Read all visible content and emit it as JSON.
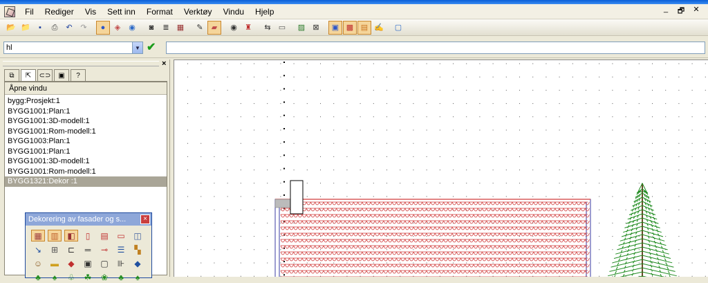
{
  "menubar": {
    "items": [
      "Fil",
      "Rediger",
      "Vis",
      "Sett inn",
      "Format",
      "Verktøy",
      "Vindu",
      "Hjelp"
    ],
    "window_controls": [
      "_",
      "🗗",
      "✕"
    ]
  },
  "toolbar": {
    "buttons": [
      "open-folder",
      "folder",
      "save",
      "print",
      "undo",
      "redo",
      "sep",
      "sphere",
      "cube",
      "blue-sphere",
      "sep",
      "stamp",
      "stack",
      "grid-select",
      "sep",
      "pencil",
      "eraser",
      "sep",
      "eye",
      "red-pen",
      "sep",
      "mirror",
      "box",
      "sep",
      "picture",
      "cross-box",
      "sep",
      "frame",
      "select-grid",
      "fill-grid",
      "pen-edit",
      "sep",
      "blue-box"
    ],
    "active": [
      7,
      16,
      27,
      28,
      29
    ]
  },
  "inputbar": {
    "combo_value": "hl",
    "combo_arrow": "▼",
    "confirm_glyph": "✔",
    "command_value": ""
  },
  "leftpanel": {
    "close_glyph": "×",
    "header": "Åpne vindu",
    "items": [
      "bygg:Prosjekt:1",
      "BYGG1001:Plan:1",
      "BYGG1001:3D-modell:1",
      "BYGG1001:Rom-modell:1",
      "BYGG1003:Plan:1",
      "BYGG1001:Plan:1",
      "BYGG1001:3D-modell:1",
      "BYGG1001:Rom-modell:1",
      "BYGG1321:Dekor :1"
    ],
    "selected_index": 8
  },
  "palette": {
    "title": "Dekorering av fasader og s...",
    "close_glyph": "×"
  },
  "colors": {
    "roof_tile": "#d03a3a",
    "wall_outline": "#3a3aa0",
    "tree_green": "#1d8a1d",
    "grid_dot": "#555555"
  }
}
